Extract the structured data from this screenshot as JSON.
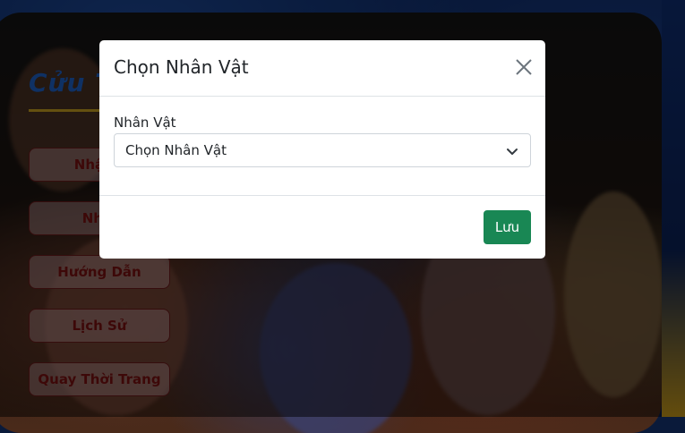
{
  "page": {
    "title": "Cửu T",
    "menu": [
      {
        "label": "Nhận t"
      },
      {
        "label": "Nhiệ"
      },
      {
        "label": "Hướng Dẫn"
      },
      {
        "label": "Lịch Sử"
      },
      {
        "label": "Quay Thời Trang"
      }
    ]
  },
  "modal": {
    "title": "Chọn Nhân Vật",
    "close_icon": "close-icon",
    "field_label": "Nhân Vật",
    "select_value": "Chọn Nhân Vật",
    "select_icon": "chevron-down-icon",
    "save_label": "Lưu"
  },
  "colors": {
    "save_button": "#198754",
    "menu_text": "#7a1010",
    "title_text": "#1e63c8"
  }
}
